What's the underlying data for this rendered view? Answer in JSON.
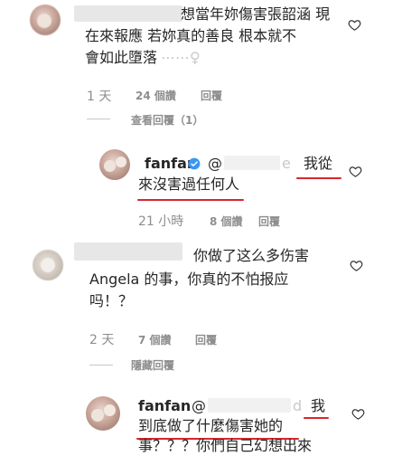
{
  "comments": [
    {
      "text_line1": "想當年妳傷害張韶涵 現",
      "text_line2": "在來報應 若妳真的善良 根本就不",
      "text_line3": "會如此墮落",
      "tail_faded": "⋯⋯♀",
      "time": "1 天",
      "likes": "24 個讚",
      "reply": "回覆",
      "view_replies": "查看回覆（1）"
    },
    {
      "username": "fanfan",
      "mention_prefix": "@",
      "mention_tail": "e",
      "text_line1_part": "我從",
      "text_line2": "來沒害過任何人",
      "time": "21 小時",
      "likes": "8 個讚",
      "reply": "回覆"
    },
    {
      "text_line1": "你做了这么多伤害",
      "text_line2": "Angela 的事，你真的不怕报应",
      "text_line3": "吗！？",
      "time": "2 天",
      "likes": "7 個讚",
      "reply": "回覆",
      "hide_replies": "隱藏回覆"
    },
    {
      "username": "fanfan",
      "mention_prefix": "@",
      "mention_tail": "d",
      "text_line1_part": "我",
      "text_line2": "到底做了什麼傷害她的",
      "text_line3": "事？？？你們自己幻想出來"
    }
  ]
}
